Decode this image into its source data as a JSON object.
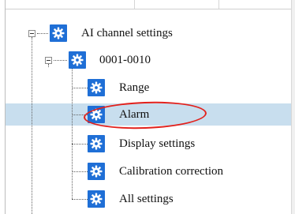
{
  "tree": {
    "root": {
      "label": "AI channel settings",
      "icon": "gear-icon",
      "expander": "collapse"
    },
    "group": {
      "label": "0001-0010",
      "icon": "gear-icon",
      "expander": "collapse"
    },
    "items": [
      {
        "label": "Range",
        "icon": "gear-icon",
        "selected": false
      },
      {
        "label": "Alarm",
        "icon": "gear-icon",
        "selected": true
      },
      {
        "label": "Display settings",
        "icon": "gear-icon",
        "selected": false
      },
      {
        "label": "Calibration correction",
        "icon": "gear-icon",
        "selected": false
      },
      {
        "label": "All settings",
        "icon": "gear-icon",
        "selected": false
      }
    ]
  },
  "colors": {
    "icon_bg": "#1f6fd6",
    "selection_bg": "#c8deee",
    "annotation": "#e2211c"
  },
  "annotation": {
    "target": "Alarm",
    "shape": "oval"
  }
}
